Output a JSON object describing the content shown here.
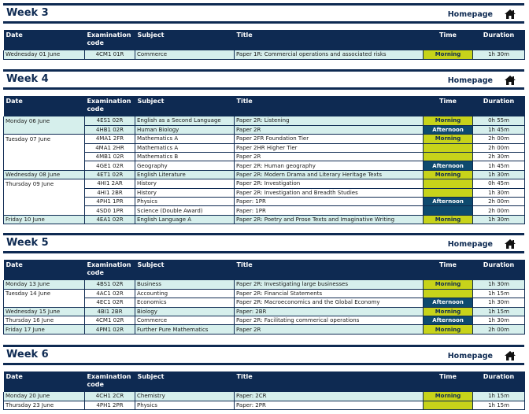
{
  "homepage_label": "Homepage",
  "headers": [
    "Date",
    "Examination code",
    "Subject",
    "Title",
    "Time",
    "Duration"
  ],
  "weeks": [
    {
      "title": "Week 3",
      "rows": [
        {
          "date": "Wednesday 01 June",
          "code": "4CM1 01R",
          "subject": "Commerce",
          "title": "Paper 1R: Commercial operations and associated risks",
          "time": "Morning",
          "duration": "1h 30m"
        }
      ]
    },
    {
      "title": "Week 4",
      "rows": [
        {
          "date": "Monday 06 June",
          "code": "4ES1 02R",
          "subject": "English as a Second Language",
          "title": "Paper 2R: Listening",
          "time": "Morning",
          "duration": "0h 55m"
        },
        {
          "date": "",
          "code": "4HB1 02R",
          "subject": "Human Biology",
          "title": "Paper 2R",
          "time": "Afternoon",
          "duration": "1h 45m"
        },
        {
          "date": "Tuesday 07 June",
          "code": "4MA1 2FR",
          "subject": "Mathematics A",
          "title": "Paper 2FR Foundation Tier",
          "time": "Morning",
          "duration": "2h 00m"
        },
        {
          "date": "",
          "code": "4MA1 2HR",
          "subject": "Mathematics A",
          "title": "Paper 2HR Higher Tier",
          "time": "",
          "duration": "2h 00m"
        },
        {
          "date": "",
          "code": "4MB1 02R",
          "subject": "Mathematics B",
          "title": "Paper 2R",
          "time": "",
          "duration": "2h 30m"
        },
        {
          "date": "",
          "code": "4GE1 02R",
          "subject": "Geography",
          "title": "Paper 2R: Human geography",
          "time": "Afternoon",
          "duration": "1h 45m"
        },
        {
          "date": "Wednesday 08 June",
          "code": "4ET1 02R",
          "subject": "English Literature",
          "title": "Paper 2R: Modern Drama and Literary Heritage Texts",
          "time": "Morning",
          "duration": "1h 30m"
        },
        {
          "date": "Thursday 09 June",
          "code": "4HI1 2AR",
          "subject": "History",
          "title": "Paper 2R: Investigation",
          "time": "",
          "duration": "0h 45m"
        },
        {
          "date": "",
          "code": "4HI1 2BR",
          "subject": "History",
          "title": "Paper 2R: Investigation and Breadth Studies",
          "time": "",
          "duration": "1h 30m"
        },
        {
          "date": "",
          "code": "4PH1 1PR",
          "subject": "Physics",
          "title": "Paper: 1PR",
          "time": "Afternoon",
          "duration": "2h 00m"
        },
        {
          "date": "",
          "code": "4SD0 1PR",
          "subject": "Science (Double Award)",
          "title": "Paper: 1PR",
          "time": "",
          "duration": "2h 00m"
        },
        {
          "date": "Friday 10 June",
          "code": "4EA1 02R",
          "subject": "English Language A",
          "title": "Paper 2R: Poetry and Prose Texts and Imaginative Writing",
          "time": "Morning",
          "duration": "1h 30m"
        }
      ]
    },
    {
      "title": "Week 5",
      "rows": [
        {
          "date": "Monday 13 June",
          "code": "4BS1 02R",
          "subject": "Business",
          "title": "Paper 2R: Investigating large businesses",
          "time": "Morning",
          "duration": "1h 30m"
        },
        {
          "date": "Tuesday 14 June",
          "code": "4AC1 02R",
          "subject": "Accounting",
          "title": "Paper 2R: Financial Statements",
          "time": "",
          "duration": "1h 15m"
        },
        {
          "date": "",
          "code": "4EC1 02R",
          "subject": "Economics",
          "title": "Paper 2R: Macroeconomics and the Global Economy",
          "time": "Afternoon",
          "duration": "1h 30m"
        },
        {
          "date": "Wednesday 15 June",
          "code": "4BI1 2BR",
          "subject": "Biology",
          "title": "Paper: 2BR",
          "time": "Morning",
          "duration": "1h 15m"
        },
        {
          "date": "Thursday 16 June",
          "code": "4CM1 02R",
          "subject": "Commerce",
          "title": "Paper 2R: Facilitating commerical operations",
          "time": "Afternoon",
          "duration": "1h 30m"
        },
        {
          "date": "Friday 17 June",
          "code": "4PM1 02R",
          "subject": "Further Pure Mathematics",
          "title": "Paper 2R",
          "time": "Morning",
          "duration": "2h 00m"
        }
      ]
    },
    {
      "title": "Week 6",
      "rows": [
        {
          "date": "Monday 20 June",
          "code": "4CH1 2CR",
          "subject": "Chemistry",
          "title": "Paper: 2CR",
          "time": "Morning",
          "duration": "1h 15m"
        },
        {
          "date": "Thursday 23 June",
          "code": "4PH1 2PR",
          "subject": "Physics",
          "title": "Paper: 2PR",
          "time": "",
          "duration": "1h 15m"
        }
      ]
    }
  ],
  "icons": {
    "home": "home-icon"
  },
  "colors": {
    "navy": "#0e2a52",
    "morning": "#c7d31a",
    "afternoon": "#0e4a6e",
    "row_alt": "#d6efec"
  }
}
